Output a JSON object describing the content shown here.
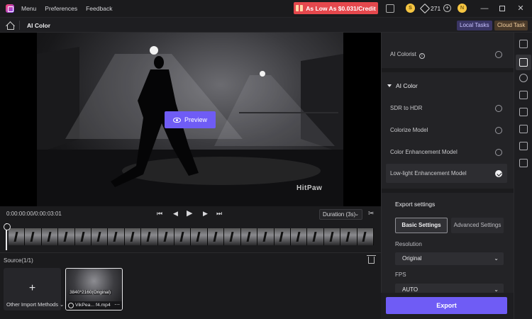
{
  "titlebar": {
    "menu": [
      "Menu",
      "Preferences",
      "Feedback"
    ],
    "promo_text": "As Low As $0.031/Credit",
    "credits": "271",
    "coin_label": "S",
    "avatar_label": "N"
  },
  "subbar": {
    "title": "AI Color",
    "local_tasks": "Local Tasks",
    "cloud_task": "Cloud Task"
  },
  "preview": {
    "button_label": "Preview",
    "watermark": "HitPaw"
  },
  "controls": {
    "timecode": "0:00:00:00/0:00:03:01",
    "duration_label": "Duration (3s)"
  },
  "source": {
    "title": "Source(1/1)",
    "import_label": "Other Import Methods",
    "clip_resolution": "3840*2160(Original)",
    "clip_name": "VikPea... f4.mp4"
  },
  "panel": {
    "ai_colorist": "AI Colorist",
    "section_title": "AI Color",
    "options": [
      {
        "label": "SDR to HDR",
        "checked": false
      },
      {
        "label": "Colorize Model",
        "checked": false
      },
      {
        "label": "Color Enhancement Model",
        "checked": false
      },
      {
        "label": "Low-light Enhancement Model",
        "checked": true
      }
    ],
    "export_settings": "Export settings",
    "tab_basic": "Basic Settings",
    "tab_advanced": "Advanced Settings",
    "resolution_label": "Resolution",
    "resolution_value": "Original",
    "fps_label": "FPS",
    "fps_value": "AUTO",
    "export_button": "Export"
  },
  "colors": {
    "accent": "#6f5cf5",
    "promo": "#e5484d",
    "background": "#1b1b1d"
  }
}
